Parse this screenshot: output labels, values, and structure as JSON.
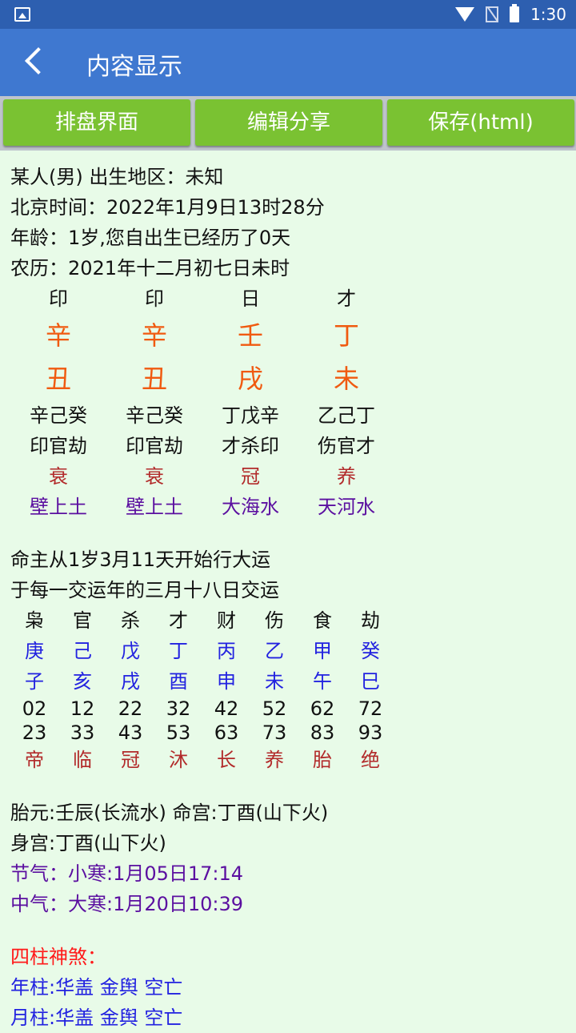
{
  "status_bar": {
    "time": "1:30",
    "icons": [
      "image-icon",
      "wifi-icon",
      "no-sim-icon",
      "battery-icon"
    ]
  },
  "app_bar": {
    "title": "内容显示"
  },
  "toolbar": {
    "btn1": "排盘界面",
    "btn2": "编辑分享",
    "btn3": "保存(html)"
  },
  "info": {
    "line1": "某人(男) 出生地区：未知",
    "line2": "北京时间：2022年1月9日13时28分",
    "line3": "年龄：1岁,您自出生已经历了0天",
    "line4": "农历：2021年十二月初七日未时"
  },
  "pillars": {
    "shishen": [
      "印",
      "印",
      "日",
      "才"
    ],
    "stems": [
      "辛",
      "辛",
      "壬",
      "丁"
    ],
    "branches": [
      "丑",
      "丑",
      "戌",
      "未"
    ],
    "hidden": [
      "辛己癸",
      "辛己癸",
      "丁戊辛",
      "乙己丁"
    ],
    "hidden_gods": [
      "印官劫",
      "印官劫",
      "才杀印",
      "伤官才"
    ],
    "stages": [
      "衰",
      "衰",
      "冠",
      "养"
    ],
    "nayin": [
      "壁上土",
      "壁上土",
      "大海水",
      "天河水"
    ]
  },
  "dayun_intro": {
    "line1": "命主从1岁3月11天开始行大运",
    "line2": "于每一交运年的三月十八日交运"
  },
  "dayun": {
    "gods": [
      "枭",
      "官",
      "杀",
      "才",
      "财",
      "伤",
      "食",
      "劫"
    ],
    "stems": [
      "庚",
      "己",
      "戊",
      "丁",
      "丙",
      "乙",
      "甲",
      "癸"
    ],
    "branches": [
      "子",
      "亥",
      "戌",
      "酉",
      "申",
      "未",
      "午",
      "巳"
    ],
    "start_ages": [
      "02",
      "12",
      "22",
      "32",
      "42",
      "52",
      "62",
      "72"
    ],
    "end_ages": [
      "23",
      "33",
      "43",
      "53",
      "63",
      "73",
      "83",
      "93"
    ],
    "stages": [
      "帝",
      "临",
      "冠",
      "沐",
      "长",
      "养",
      "胎",
      "绝"
    ]
  },
  "extra": {
    "line1": "胎元:壬辰(长流水) 命宫:丁酉(山下火)",
    "line2": "身宫:丁酉(山下火)",
    "jieqi": "节气：小寒:1月05日17:14",
    "zhongqi": "中气：大寒:1月20日10:39"
  },
  "shensha": {
    "title": "四柱神煞：",
    "year": "年柱:华盖 金舆 空亡",
    "month": "月柱:华盖 金舆 空亡"
  }
}
